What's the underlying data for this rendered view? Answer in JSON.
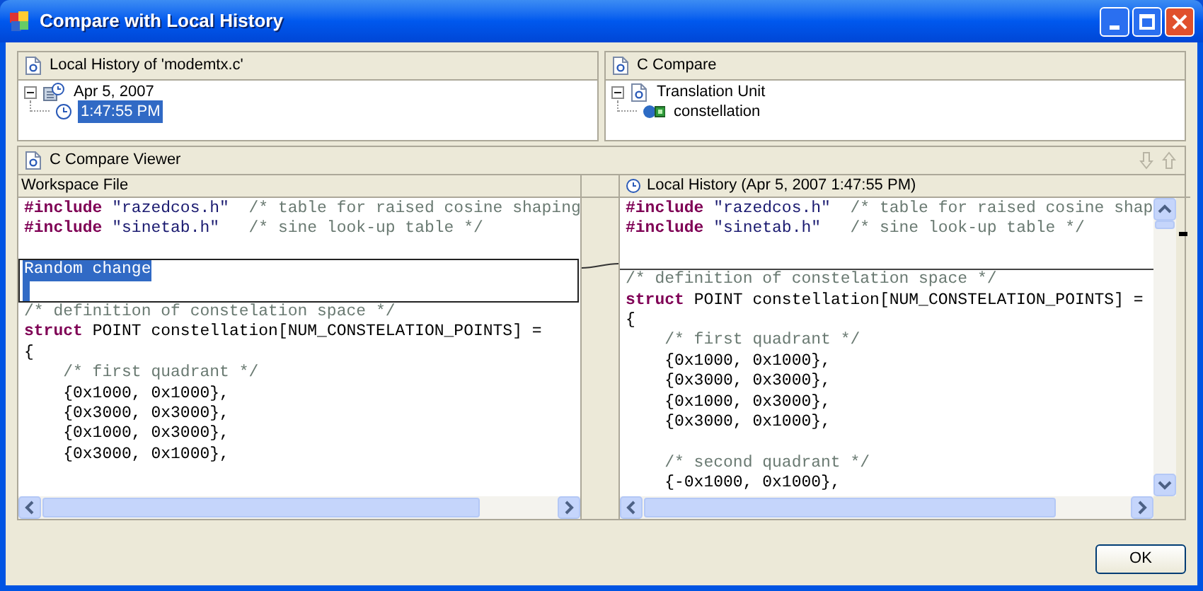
{
  "window": {
    "title": "Compare with Local History"
  },
  "history_pane": {
    "title": "Local History of 'modemtx.c'",
    "tree": [
      {
        "kind": "date",
        "label": "Apr 5, 2007",
        "expanded": true,
        "selected": false,
        "children": [
          {
            "kind": "time",
            "label": "1:47:55 PM",
            "selected": true
          }
        ]
      }
    ]
  },
  "structure_pane": {
    "title": "C Compare",
    "tree": [
      {
        "kind": "file",
        "label": "Translation Unit",
        "expanded": true,
        "selected": false,
        "children": [
          {
            "kind": "variable",
            "label": "constellation",
            "selected": false
          }
        ]
      }
    ]
  },
  "compare_viewer": {
    "title": "C Compare Viewer",
    "left": {
      "title": "Workspace File",
      "lines": [
        {
          "kind": "code",
          "segments": [
            {
              "kind": "keyword",
              "text": "#include"
            },
            {
              "kind": "string",
              "text": " \"razedcos.h\""
            },
            {
              "kind": "comment",
              "text": "  /* table for raised cosine shaping"
            }
          ]
        },
        {
          "kind": "code",
          "segments": [
            {
              "kind": "keyword",
              "text": "#include"
            },
            {
              "kind": "string",
              "text": " \"sinetab.h\""
            },
            {
              "kind": "comment",
              "text": "   /* sine look-up table */"
            }
          ]
        },
        {
          "kind": "blank"
        },
        {
          "kind": "change",
          "text": "Random change",
          "selected": true
        },
        {
          "kind": "code",
          "segments": [
            {
              "kind": "comment",
              "text": "/* definition of constelation space */"
            }
          ]
        },
        {
          "kind": "code",
          "segments": [
            {
              "kind": "keyword",
              "text": "struct"
            },
            {
              "kind": "plain",
              "text": " POINT constellation[NUM_CONSTELATION_POINTS] ="
            }
          ]
        },
        {
          "kind": "code",
          "segments": [
            {
              "kind": "plain",
              "text": "{"
            }
          ]
        },
        {
          "kind": "code",
          "segments": [
            {
              "kind": "comment",
              "text": "    /* first quadrant */"
            }
          ]
        },
        {
          "kind": "code",
          "segments": [
            {
              "kind": "plain",
              "text": "    {0x1000, 0x1000},"
            }
          ]
        },
        {
          "kind": "code",
          "segments": [
            {
              "kind": "plain",
              "text": "    {0x3000, 0x3000},"
            }
          ]
        },
        {
          "kind": "code",
          "segments": [
            {
              "kind": "plain",
              "text": "    {0x1000, 0x3000},"
            }
          ]
        },
        {
          "kind": "code",
          "segments": [
            {
              "kind": "plain",
              "text": "    {0x3000, 0x1000},"
            }
          ]
        }
      ]
    },
    "right": {
      "title": "Local History (Apr 5, 2007 1:47:55 PM)",
      "lines": [
        {
          "kind": "code",
          "segments": [
            {
              "kind": "keyword",
              "text": "#include"
            },
            {
              "kind": "string",
              "text": " \"razedcos.h\""
            },
            {
              "kind": "comment",
              "text": "  /* table for raised cosine shap"
            }
          ]
        },
        {
          "kind": "code",
          "segments": [
            {
              "kind": "keyword",
              "text": "#include"
            },
            {
              "kind": "string",
              "text": " \"sinetab.h\""
            },
            {
              "kind": "comment",
              "text": "   /* sine look-up table */"
            }
          ]
        },
        {
          "kind": "blank"
        },
        {
          "kind": "change_anchor"
        },
        {
          "kind": "code",
          "segments": [
            {
              "kind": "comment",
              "text": "/* definition of constelation space */"
            }
          ]
        },
        {
          "kind": "code",
          "segments": [
            {
              "kind": "keyword",
              "text": "struct"
            },
            {
              "kind": "plain",
              "text": " POINT constellation[NUM_CONSTELATION_POINTS] ="
            }
          ]
        },
        {
          "kind": "code",
          "segments": [
            {
              "kind": "plain",
              "text": "{"
            }
          ]
        },
        {
          "kind": "code",
          "segments": [
            {
              "kind": "comment",
              "text": "    /* first quadrant */"
            }
          ]
        },
        {
          "kind": "code",
          "segments": [
            {
              "kind": "plain",
              "text": "    {0x1000, 0x1000},"
            }
          ]
        },
        {
          "kind": "code",
          "segments": [
            {
              "kind": "plain",
              "text": "    {0x3000, 0x3000},"
            }
          ]
        },
        {
          "kind": "code",
          "segments": [
            {
              "kind": "plain",
              "text": "    {0x1000, 0x3000},"
            }
          ]
        },
        {
          "kind": "code",
          "segments": [
            {
              "kind": "plain",
              "text": "    {0x3000, 0x1000},"
            }
          ]
        },
        {
          "kind": "blank"
        },
        {
          "kind": "code",
          "segments": [
            {
              "kind": "comment",
              "text": "    /* second quadrant */"
            }
          ]
        },
        {
          "kind": "code",
          "segments": [
            {
              "kind": "plain",
              "text": "    {-0x1000, 0x1000},"
            }
          ]
        }
      ]
    }
  },
  "buttons": [
    {
      "label": "OK"
    }
  ]
}
